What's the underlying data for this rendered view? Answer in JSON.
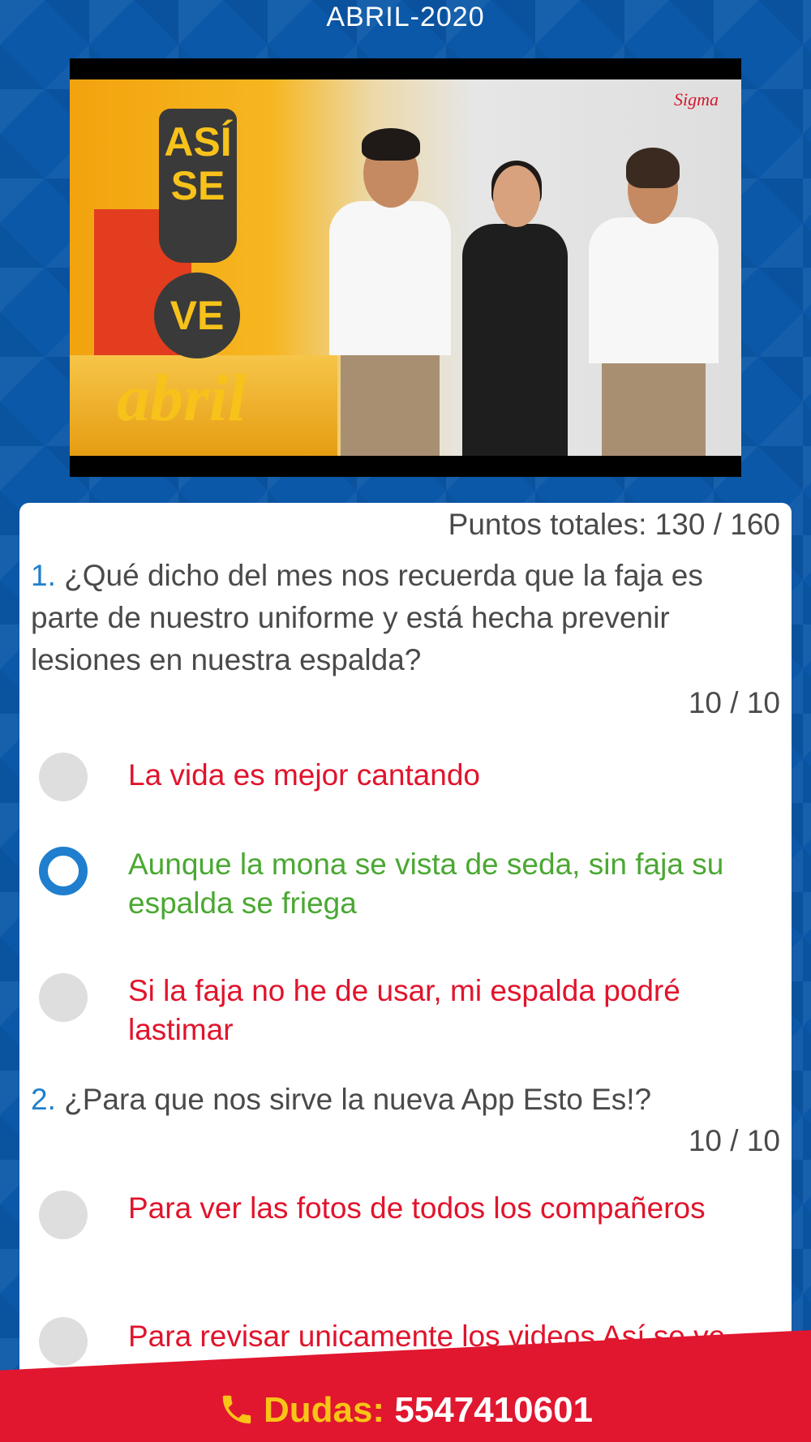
{
  "header": {
    "title": "ABRIL-2020"
  },
  "video": {
    "logo_top": "ASÍ SE",
    "logo_ve": "VE",
    "logo_abril": "abril",
    "brand": "Sigma"
  },
  "quiz": {
    "total_label": "Puntos totales: 130 / 160",
    "questions": [
      {
        "number": "1.",
        "text": "¿Qué dicho del mes nos recuerda que la faja es parte de nuestro uniforme y está hecha prevenir lesiones en nuestra espalda?",
        "score": "10 / 10",
        "options": [
          {
            "text": "La vida es mejor cantando",
            "status": "incorrect",
            "selected": false
          },
          {
            "text": "Aunque la mona se vista de seda, sin faja su espalda se friega",
            "status": "correct",
            "selected": true
          },
          {
            "text": "Si la faja no he de usar, mi espalda podré lastimar",
            "status": "incorrect",
            "selected": false
          }
        ]
      },
      {
        "number": "2.",
        "text": "¿Para que nos sirve la nueva App Esto Es!?",
        "score": "10 / 10",
        "options": [
          {
            "text": "Para ver las fotos de todos los compañeros",
            "status": "incorrect",
            "selected": false
          },
          {
            "text": "Para revisar unicamente los videos Así se ve",
            "status": "incorrect",
            "selected": false
          }
        ]
      }
    ]
  },
  "footer": {
    "icon": "phone-icon",
    "label": "Dudas:",
    "phone": "5547410601"
  },
  "colors": {
    "background": "#0b57a8",
    "accent": "#1f7fce",
    "correct": "#4aa832",
    "incorrect": "#e0142c",
    "footer": "#e1162f",
    "footer_label": "#f8c417"
  }
}
